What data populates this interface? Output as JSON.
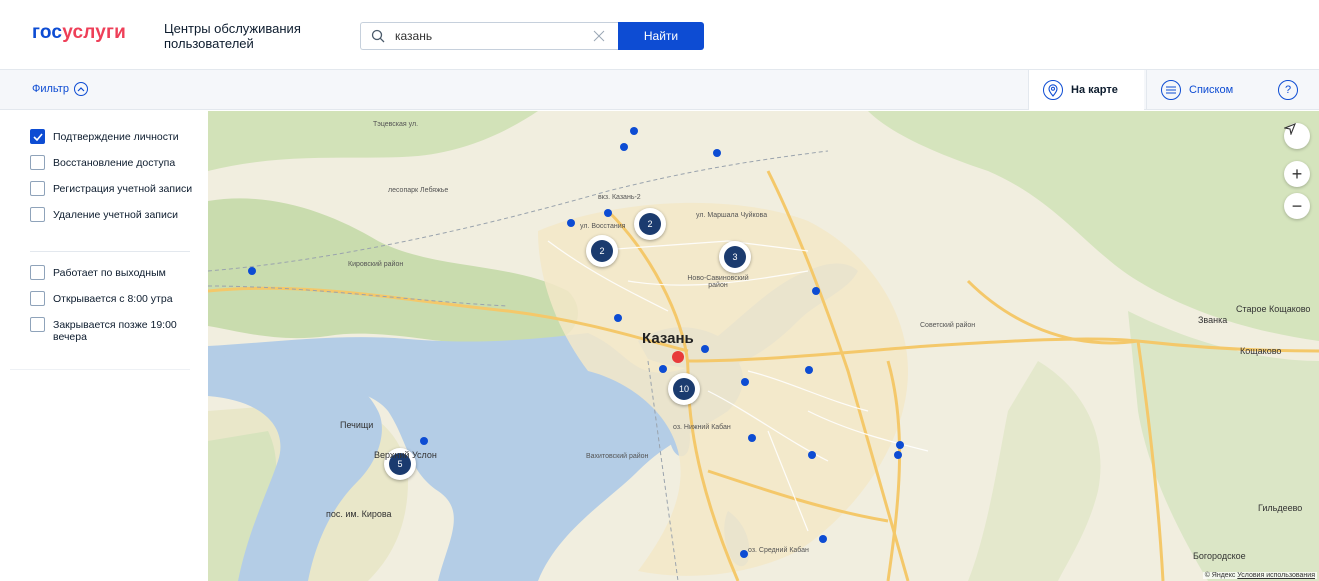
{
  "header": {
    "logo_part1": "гос",
    "logo_part2": "услуги",
    "page_title": "Центры обслуживания пользователей",
    "search_value": "казань",
    "search_button": "Найти"
  },
  "toolbar": {
    "filter_label": "Фильтр",
    "map_tab": "На карте",
    "list_tab": "Списком",
    "help_label": "?"
  },
  "filters": {
    "services": [
      {
        "label": "Подтверждение личности",
        "checked": true
      },
      {
        "label": "Восстановление доступа",
        "checked": false
      },
      {
        "label": "Регистрация учетной записи",
        "checked": false
      },
      {
        "label": "Удаление учетной записи",
        "checked": false
      }
    ],
    "schedule": [
      {
        "label": "Работает по выходным",
        "checked": false
      },
      {
        "label": "Открывается с 8:00 утра",
        "checked": false
      },
      {
        "label": "Закрывается позже 19:00 вечера",
        "checked": false
      }
    ]
  },
  "map": {
    "city": "Казань",
    "labels": {
      "kirovsky": "Кировский район",
      "novo_savinovsky": "Ново-Савиновский район",
      "sovetsky": "Советский район",
      "vakhitovsky": "Вахитовский район",
      "pechishchi": "Печищи",
      "verkhny_uslon": "Верхний Услон",
      "pos_kirova": "пос. им. Кирова",
      "zvanka": "Званка",
      "staroe_koshchakovo": "Старое Кощаково",
      "koshchakovo": "Кощаково",
      "gildeevo": "Гильдеево",
      "bogorodskoe": "Богородское",
      "lesopark": "лесопарк Лебяжье",
      "ul_chuykova": "ул. Маршала Чуйкова",
      "ul_vosstaniya": "ул. Восстания",
      "vkz_kazan2": "вкз. Казань-2",
      "sredny_kaban": "оз. Средний Кабан",
      "nizhny_kaban": "оз. Нижний Кабан"
    },
    "clusters": [
      "2",
      "2",
      "3",
      "10",
      "5"
    ],
    "controls": {
      "locate_icon": "arrow-locate-icon",
      "zoom_in": "+",
      "zoom_out": "−"
    },
    "copyright_brand": "© Яндекс",
    "copyright_link": "Условия использования"
  }
}
